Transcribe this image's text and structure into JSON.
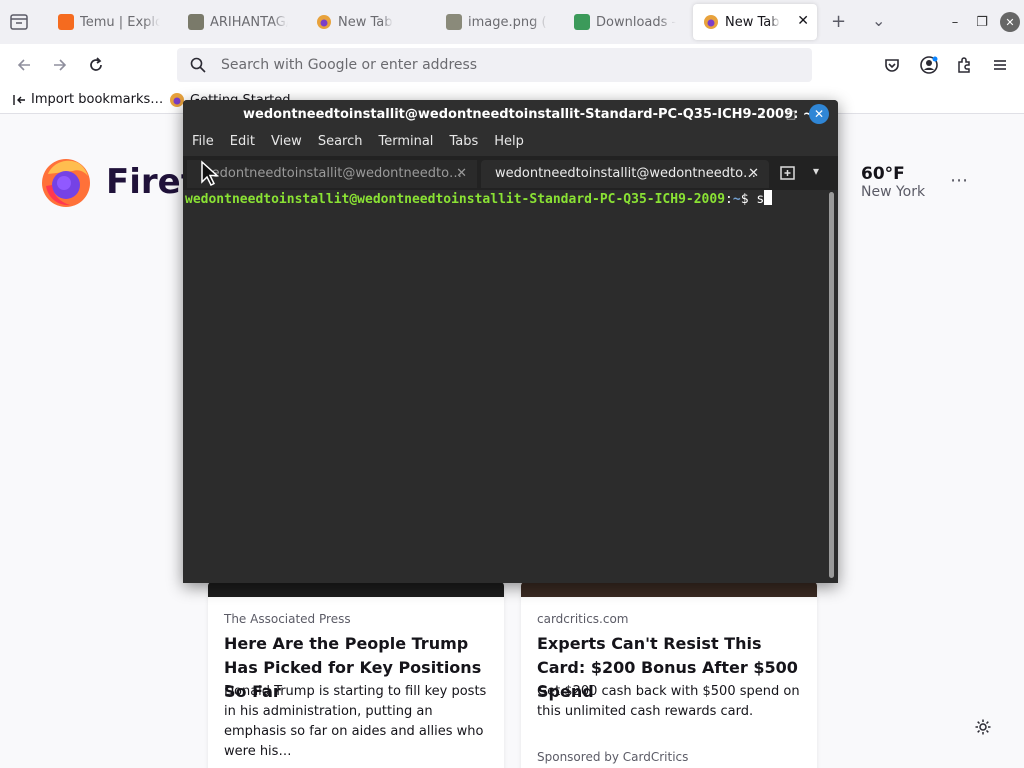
{
  "browser": {
    "tabs": [
      {
        "label": "Temu | Explo",
        "favicon_color": "#f56b1f",
        "active": false
      },
      {
        "label": "ARIHANTAG/",
        "favicon_color": "#7a7a6a",
        "active": false
      },
      {
        "label": "New Tab",
        "favicon_color": "#e8a23c",
        "active": false
      },
      {
        "label": "image.png (P",
        "favicon_color": "#8a8a7a",
        "active": false
      },
      {
        "label": "Downloads -",
        "favicon_color": "#3c9a5a",
        "active": false
      },
      {
        "label": "New Tab",
        "favicon_color": "#e8a23c",
        "active": true
      }
    ],
    "close_tab_glyph": "✕",
    "new_tab_glyph": "+",
    "tab_list_glyph": "⌄",
    "window": {
      "minimize": "–",
      "maximize": "❐",
      "close": "✕"
    },
    "search_placeholder": "Search with Google or enter address",
    "bookmarks": [
      {
        "label": "Import bookmarks…",
        "icon": "import-icon"
      },
      {
        "label": "Getting Started",
        "icon": "firefox-icon"
      }
    ]
  },
  "newtab": {
    "brand": "Firefox",
    "weather": {
      "temp": "60°F",
      "city": "New York",
      "more": "⋯"
    },
    "cards": [
      {
        "source": "The Associated Press",
        "title": "Here Are the People Trump Has Picked for Key Positions So Far",
        "excerpt": "Donald Trump is starting to fill key posts in his administration, putting an emphasis so far on aides and allies who were his…",
        "sponsor": ""
      },
      {
        "source": "cardcritics.com",
        "title": "Experts Can't Resist This Card: $200 Bonus After $500 Spend",
        "excerpt": "Get $200 cash back with $500 spend on this unlimited cash rewards card.",
        "sponsor": "Sponsored by CardCritics"
      }
    ]
  },
  "terminal": {
    "title": "wedontneedtoinstallit@wedontneedtoinstallit-Standard-PC-Q35-ICH9-2009: ~",
    "controls": {
      "minimize": "–",
      "maximize": "□",
      "close": "✕"
    },
    "menu": [
      "File",
      "Edit",
      "View",
      "Search",
      "Terminal",
      "Tabs",
      "Help"
    ],
    "tabs": [
      {
        "label": "wedontneedtoinstallit@wedontneedto…",
        "close": "✕",
        "active": false
      },
      {
        "label": "wedontneedtoinstallit@wedontneedto…",
        "close": "✕",
        "active": true
      }
    ],
    "tab_menu_glyph": "▾",
    "prompt": {
      "user_host": "wedontneedtoinstallit@wedontneedtoinstallit-Standard-PC-Q35-ICH9-2009",
      "sep": ":",
      "path": "~",
      "dollar": "$ ",
      "command": "s"
    }
  },
  "colors": {
    "terminal_bg": "#2c2c2c",
    "prompt_green": "#8ae234",
    "prompt_blue": "#729fcf",
    "close_blue": "#2f86d6"
  }
}
